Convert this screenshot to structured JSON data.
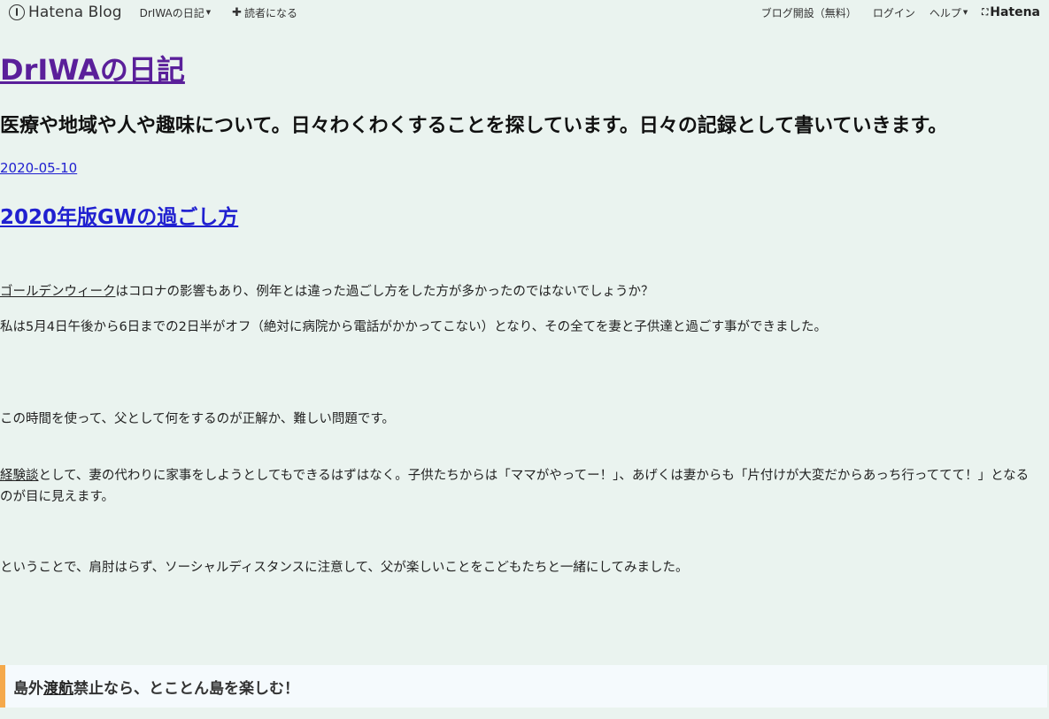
{
  "header": {
    "logo_text": "Hatena Blog",
    "blog_menu_label": "DrIWAの日記",
    "subscribe_label": "読者になる",
    "open_blog_label": "ブログ開設（無料）",
    "login_label": "ログイン",
    "help_label": "ヘルプ",
    "hatena_label": "Hatena"
  },
  "blog": {
    "title": "DrIWAの日記",
    "description": "医療や地域や人や趣味について。日々わくわくすることを探しています。日々の記録として書いていきます。"
  },
  "entry": {
    "date": "2020-05-10",
    "title": "2020年版GWの過ごし方",
    "p1_link": "ゴールデンウィーク",
    "p1_rest": "はコロナの影響もあり、例年とは違った過ごし方をした方が多かったのではないでしょうか？",
    "p2": "私は5月4日午後から6日までの2日半がオフ（絶対に病院から電話がかかってこない）となり、その全てを妻と子供達と過ごす事ができました。",
    "p3": "この時間を使って、父として何をするのが正解か、難しい問題です。",
    "p4_link": "経験談",
    "p4_rest": "として、妻の代わりに家事をしようとしてもできるはずはなく。子供たちからは「ママがやってー！」、あげくは妻からも「片付けが大変だからあっち行っててて！」となるのが目に見えます。",
    "p5": "ということで、肩肘はらず、ソーシャルディスタンスに注意して、父が楽しいことをこどもたちと一緒にしてみました。",
    "section_pre": "島外",
    "section_link": "渡航",
    "section_post": "禁止なら、とことん島を楽しむ！"
  },
  "colors": {
    "background": "#eaf3ef",
    "title_visited": "#5a1f9a",
    "link": "#2020d0",
    "section_accent": "#f5a94b",
    "section_bg": "#f5fafd"
  }
}
